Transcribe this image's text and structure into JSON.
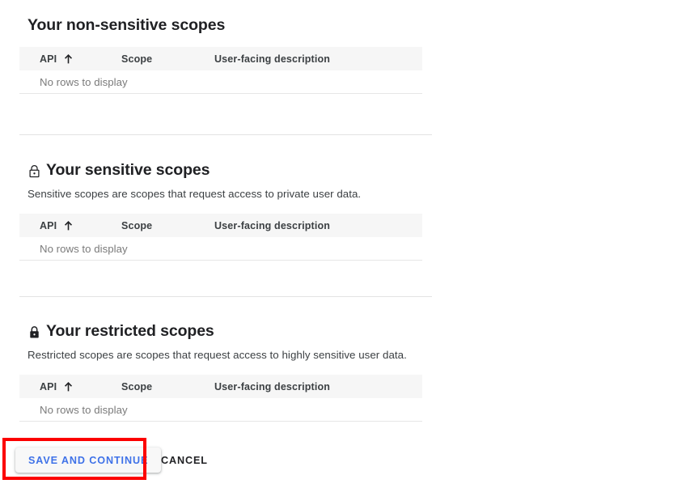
{
  "colors": {
    "accent_blue": "#3f72e8",
    "highlight_red": "#fc0000",
    "table_header_bg": "#f6f6f6",
    "divider": "#e3e3e3",
    "muted_text": "#7a7a7a",
    "text": "#202124"
  },
  "table_columns": {
    "api": "API",
    "scope": "Scope",
    "description": "User-facing description"
  },
  "empty_message": "No rows to display",
  "sections": [
    {
      "id": "non-sensitive",
      "heading": "Your non-sensitive scopes",
      "icon": null,
      "description": null
    },
    {
      "id": "sensitive",
      "heading": "Your sensitive scopes",
      "icon": "lock-outline-icon",
      "description": "Sensitive scopes are scopes that request access to private user data."
    },
    {
      "id": "restricted",
      "heading": "Your restricted scopes",
      "icon": "lock-filled-icon",
      "description": "Restricted scopes are scopes that request access to highly sensitive user data."
    }
  ],
  "footer": {
    "save_label": "SAVE AND CONTINUE",
    "cancel_label": "CANCEL"
  }
}
